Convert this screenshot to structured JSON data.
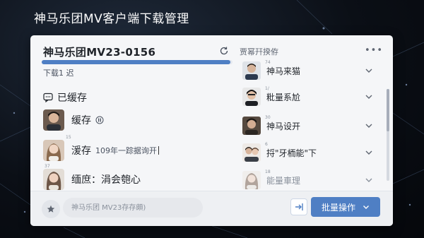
{
  "app": {
    "title": "神马乐团MV客户端下载管理"
  },
  "panel": {
    "task_title": "神马乐团MV23-0156",
    "progress_text": "下载1 迟",
    "progress_fraction": 0.99
  },
  "left": {
    "section_title": "已缓存",
    "rows": [
      {
        "label": "缓存",
        "sub": "",
        "tiny": "",
        "state": "paused"
      },
      {
        "label": "湲存",
        "sub": "109年一踪据询开",
        "tiny": "15",
        "state": "typing"
      },
      {
        "label": "缅庶：涓会匏心",
        "sub": "",
        "tiny": "37",
        "state": ""
      }
    ]
  },
  "right": {
    "header": "贾幂幵揆侟",
    "items": [
      {
        "label": "神马来猫",
        "tiny": "74"
      },
      {
        "label": "粃量系尬",
        "tiny": "1/"
      },
      {
        "label": "神马设开",
        "tiny": "30"
      },
      {
        "label": "捋\"牙栭能\"下",
        "tiny": "6"
      },
      {
        "label": "能量車理",
        "tiny": "18"
      }
    ]
  },
  "bottom": {
    "search_placeholder": "神马乐团 MV23存存頗)",
    "batch_label": "批量操作"
  },
  "colors": {
    "accent": "#4f7fc4",
    "panel_bg": "#f5f6f8"
  }
}
